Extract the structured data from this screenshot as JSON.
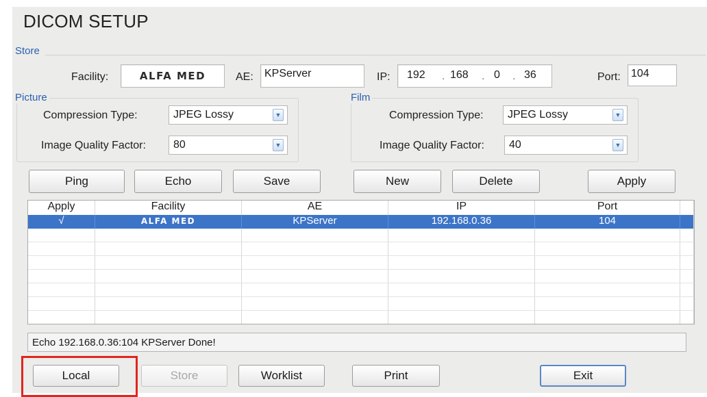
{
  "window": {
    "title": "DICOM SETUP"
  },
  "store": {
    "legend": "Store",
    "facility_label": "Facility:",
    "facility_value": "ALFA MED",
    "ae_label": "AE:",
    "ae_value": "KPServer",
    "ip_label": "IP:",
    "ip_octets": [
      "192",
      "168",
      "0",
      "36"
    ],
    "ip_sep": ".",
    "port_label": "Port:",
    "port_value": "104"
  },
  "picture": {
    "legend": "Picture",
    "compression_label": "Compression Type:",
    "compression_value": "JPEG Lossy",
    "quality_label": "Image Quality Factor:",
    "quality_value": "80"
  },
  "film": {
    "legend": "Film",
    "compression_label": "Compression Type:",
    "compression_value": "JPEG Lossy",
    "quality_label": "Image Quality Factor:",
    "quality_value": "40"
  },
  "actions": {
    "ping": "Ping",
    "echo": "Echo",
    "save": "Save",
    "new": "New",
    "delete": "Delete",
    "apply": "Apply"
  },
  "table": {
    "headers": [
      "Apply",
      "Facility",
      "AE",
      "IP",
      "Port"
    ],
    "rows": [
      {
        "apply": "√",
        "facility": "ALFA MED",
        "ae": "KPServer",
        "ip": "192.168.0.36",
        "port": "104",
        "selected": true
      }
    ]
  },
  "status": {
    "message": "Echo 192.168.0.36:104 KPServer Done!"
  },
  "footer": {
    "local": "Local",
    "store": "Store",
    "worklist": "Worklist",
    "print": "Print",
    "exit": "Exit"
  },
  "colors": {
    "accent": "#2a5fb0",
    "selection": "#3c74c8",
    "highlight": "#e0251f"
  },
  "icons": {
    "dropdown": "chevron-down-icon"
  }
}
